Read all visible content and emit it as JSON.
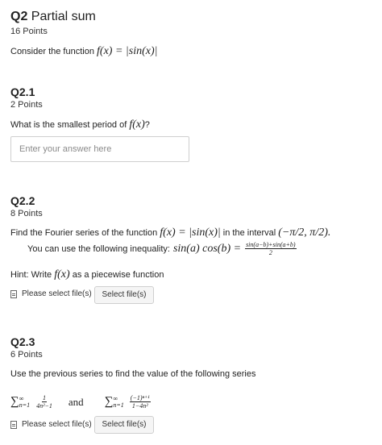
{
  "q2": {
    "number": "Q2",
    "title": "Partial sum",
    "points": "16 Points",
    "intro_text": "Consider the function",
    "intro_math": "f(x) = |sin(x)|"
  },
  "q21": {
    "title": "Q2.1",
    "points": "2 Points",
    "question_text": "What is the smallest period of",
    "question_math": "f(x)",
    "question_end": "?",
    "input_placeholder": "Enter your answer here"
  },
  "q22": {
    "title": "Q2.2",
    "points": "8 Points",
    "line1_text": "Find the Fourier series of the function",
    "line1_math": "f(x) = |sin(x)|",
    "line1_mid": "in the interval",
    "line1_interval": "(−π/2, π/2).",
    "line2_text": "You can use the following inequality:",
    "line2_math": "sin(a) cos(b) =",
    "line2_num": "sin(a−b)+sin(a+b)",
    "line2_den": "2",
    "hint_text": "Hint: Write",
    "hint_math": "f(x)",
    "hint_end": "as a piecewise function",
    "file_label": "Please select file(s)",
    "file_button": "Select file(s)"
  },
  "q23": {
    "title": "Q2.3",
    "points": "6 Points",
    "question_text": "Use the previous series to find the value of the following series",
    "sum1_upper": "∞",
    "sum1_lower": "n=1",
    "sum1_num": "1",
    "sum1_den": "4n²−1",
    "and_text": "and",
    "sum2_upper": "∞",
    "sum2_lower": "n=1",
    "sum2_num": "(−1)ⁿ⁺¹",
    "sum2_den": "1−4n²",
    "file_label": "Please select file(s)",
    "file_button": "Select file(s)"
  }
}
